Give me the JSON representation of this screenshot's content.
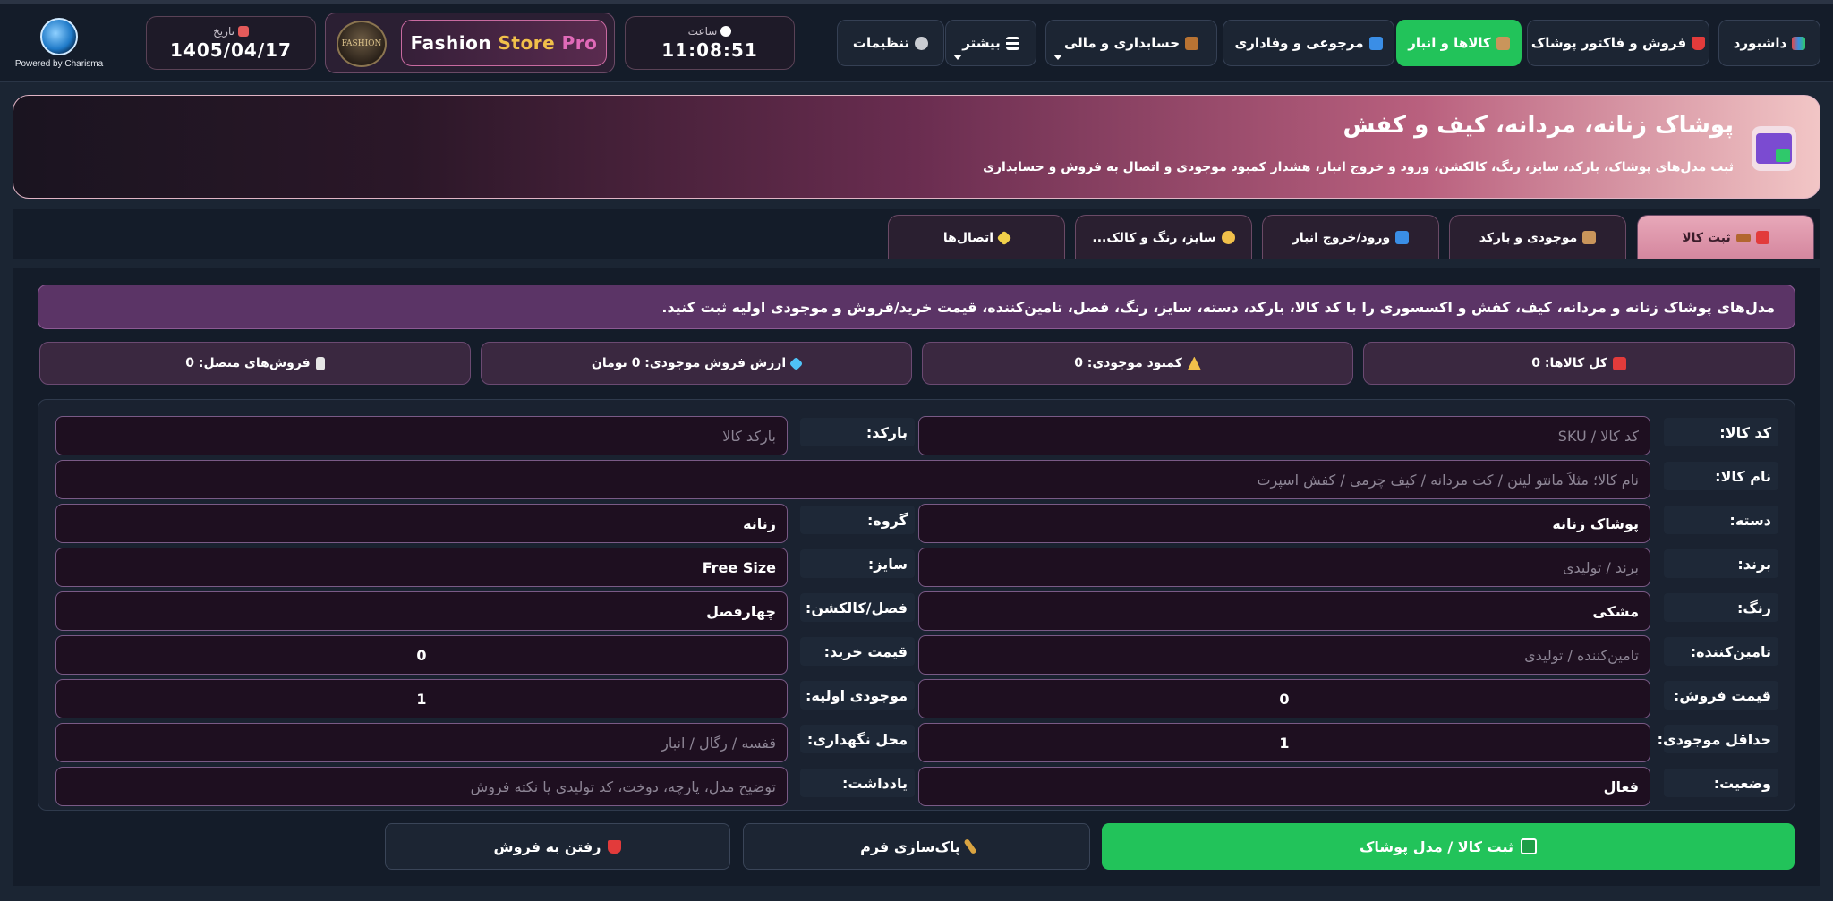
{
  "branding": {
    "charisma_text": "Powered by Charisma",
    "store_name_a": "Fashion",
    "store_name_b": "Store",
    "store_name_c": "Pro",
    "logo_text": "FASHION"
  },
  "date": {
    "label": "تاریخ",
    "value": "1405/04/17"
  },
  "clock": {
    "label": "ساعت",
    "value": "11:08:51"
  },
  "nav": {
    "dashboard": "داشبورد",
    "sales": "فروش و فاکتور پوشاک",
    "goods": "کالاها و انبار",
    "returns": "مرجوعی و وفاداری",
    "accounting": "حسابداری و مالی",
    "more": "بیشتر",
    "settings": "تنظیمات"
  },
  "hero": {
    "title": "پوشاک زنانه، مردانه، کیف و کفش",
    "subtitle": "ثبت مدل‌های پوشاک، بارکد، سایز، رنگ، کالکشن، ورود و خروج انبار، هشدار کمبود موجودی و اتصال به فروش و حسابداری"
  },
  "tabs": {
    "register": "ثبت کالا",
    "stock": "موجودی و بارکد",
    "inout": "ورود/خروج انبار",
    "size": "سایز، رنگ و کالک...",
    "links": "اتصال‌ها"
  },
  "notice": "مدل‌های پوشاک زنانه و مردانه، کیف، کفش و اکسسوری را با کد کالا، بارکد، دسته، سایز، رنگ، فصل، تامین‌کننده، قیمت خرید/فروش و موجودی اولیه ثبت کنید.",
  "stats": {
    "total": "کل کالاها: 0",
    "low": "کمبود موجودی: 0",
    "value": "ارزش فروش موجودی: 0 تومان",
    "linked": "فروش‌های متصل: 0"
  },
  "form": {
    "code_label": "کد کالا:",
    "code_placeholder": "کد کالا / SKU",
    "barcode_label": "بارکد:",
    "barcode_placeholder": "بارکد کالا",
    "name_label": "نام کالا:",
    "name_placeholder": "نام کالا؛ مثلاً مانتو لینن / کت مردانه / کیف چرمی / کفش اسپرت",
    "category_label": "دسته:",
    "category_value": "پوشاک زنانه",
    "group_label": "گروه:",
    "group_value": "زنانه",
    "brand_label": "برند:",
    "brand_placeholder": "برند / تولیدی",
    "size_label": "سایز:",
    "size_value": "Free Size",
    "color_label": "رنگ:",
    "color_value": "مشکی",
    "season_label": "فصل/کالکشن:",
    "season_value": "چهارفصل",
    "supplier_label": "تامین‌کننده:",
    "supplier_placeholder": "تامین‌کننده / تولیدی",
    "buy_label": "قیمت خرید:",
    "buy_value": "0",
    "sell_label": "قیمت فروش:",
    "sell_value": "0",
    "initstock_label": "موجودی اولیه:",
    "initstock_value": "1",
    "minstock_label": "حداقل موجودی:",
    "minstock_value": "1",
    "location_label": "محل نگهداری:",
    "location_placeholder": "قفسه / رگال / انبار",
    "status_label": "وضعیت:",
    "status_value": "فعال",
    "note_label": "یادداشت:",
    "note_placeholder": "توضیح مدل، پارچه، دوخت، کد تولیدی یا نکته فروش"
  },
  "buttons": {
    "save": "ثبت کالا / مدل پوشاک",
    "clear": "پاک‌سازی فرم",
    "goto_sales": "رفتن به فروش"
  },
  "colors": {
    "accent_green": "#22c35a",
    "accent_pink": "#e8a8b9",
    "notice_purple": "#5b3466",
    "panel_dark": "#141c29"
  }
}
